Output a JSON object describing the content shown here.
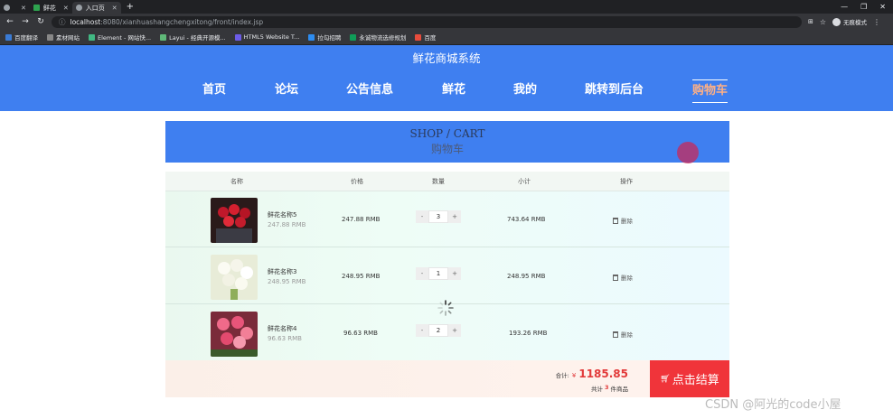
{
  "browser": {
    "tabs": [
      {
        "label": "",
        "active": false
      },
      {
        "label": "鲜花",
        "active": false
      },
      {
        "label": "入口页",
        "active": true
      }
    ],
    "new_tab": "+",
    "window_controls": [
      "—",
      "❐",
      "✕"
    ],
    "url_host": "localhost",
    "url_path": ":8080/xianhuashangchengxitong/front/index.jsp",
    "profile_label": "无痕模式",
    "bookmarks": [
      "百度翻译",
      "素材网站",
      "Element - 网站快...",
      "Layui - 经典开源模...",
      "HTML5 Website T...",
      "拉勾招聘",
      "永诚物流选修规划",
      "百度"
    ],
    "bookmark_colors": [
      "#3a7bd5",
      "#888888",
      "#41b883",
      "#5fb878",
      "#6c5ce7",
      "#2d8cf0",
      "#0f9d58",
      "#e74c3c"
    ]
  },
  "site": {
    "title": "鲜花商城系统",
    "nav": [
      {
        "label": "首页"
      },
      {
        "label": "论坛"
      },
      {
        "label": "公告信息"
      },
      {
        "label": "鲜花"
      },
      {
        "label": "我的"
      },
      {
        "label": "跳转到后台"
      },
      {
        "label": "购物车"
      }
    ]
  },
  "banner": {
    "en": "SHOP / CART",
    "cn": "购物车"
  },
  "table": {
    "headers": [
      "名称",
      "价格",
      "数量",
      "小计",
      "操作"
    ],
    "rows": [
      {
        "name": "鲜花名称5",
        "unit_price": "247.88 RMB",
        "price": "247.88 RMB",
        "qty": "3",
        "subtotal": "743.64 RMB",
        "action": "删除",
        "minus": "-",
        "plus": "+"
      },
      {
        "name": "鲜花名称3",
        "unit_price": "248.95 RMB",
        "price": "248.95 RMB",
        "qty": "1",
        "subtotal": "248.95 RMB",
        "action": "删除",
        "minus": "-",
        "plus": "+"
      },
      {
        "name": "鲜花名称4",
        "unit_price": "96.63 RMB",
        "price": "96.63 RMB",
        "qty": "2",
        "subtotal": "193.26 RMB",
        "action": "删除",
        "minus": "-",
        "plus": "+"
      }
    ]
  },
  "summary": {
    "total_label": "合计:",
    "currency": "¥",
    "total": "1185.85",
    "count_prefix": "共计",
    "count": "3",
    "count_suffix": "件商品",
    "checkout_label": "点击结算"
  },
  "colors": {
    "primary": "#3f7ff0",
    "accent": "#f0343a",
    "nav_active": "#ffb085"
  },
  "watermark": "CSDN @阿光的code小屋"
}
